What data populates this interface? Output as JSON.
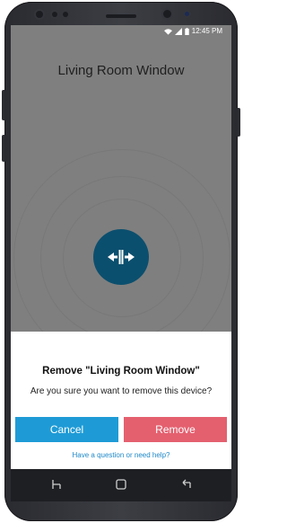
{
  "status_bar": {
    "time": "12:45 PM",
    "icons": [
      "wifi-icon",
      "signal-icon",
      "battery-icon"
    ]
  },
  "device": {
    "title": "Living Room Window",
    "icon": "window-slider-icon",
    "accent_color": "#0b4f6e"
  },
  "dialog": {
    "title": "Remove \"Living Room Window\"",
    "message": "Are you sure you want to remove this device?",
    "cancel_label": "Cancel",
    "remove_label": "Remove",
    "help_link": "Have a question or need help?",
    "colors": {
      "cancel": "#1e9bd6",
      "remove": "#e4606f",
      "link": "#1e88c9"
    }
  },
  "nav_bar": {
    "icons": [
      "recent-apps-icon",
      "home-icon",
      "back-icon"
    ]
  }
}
